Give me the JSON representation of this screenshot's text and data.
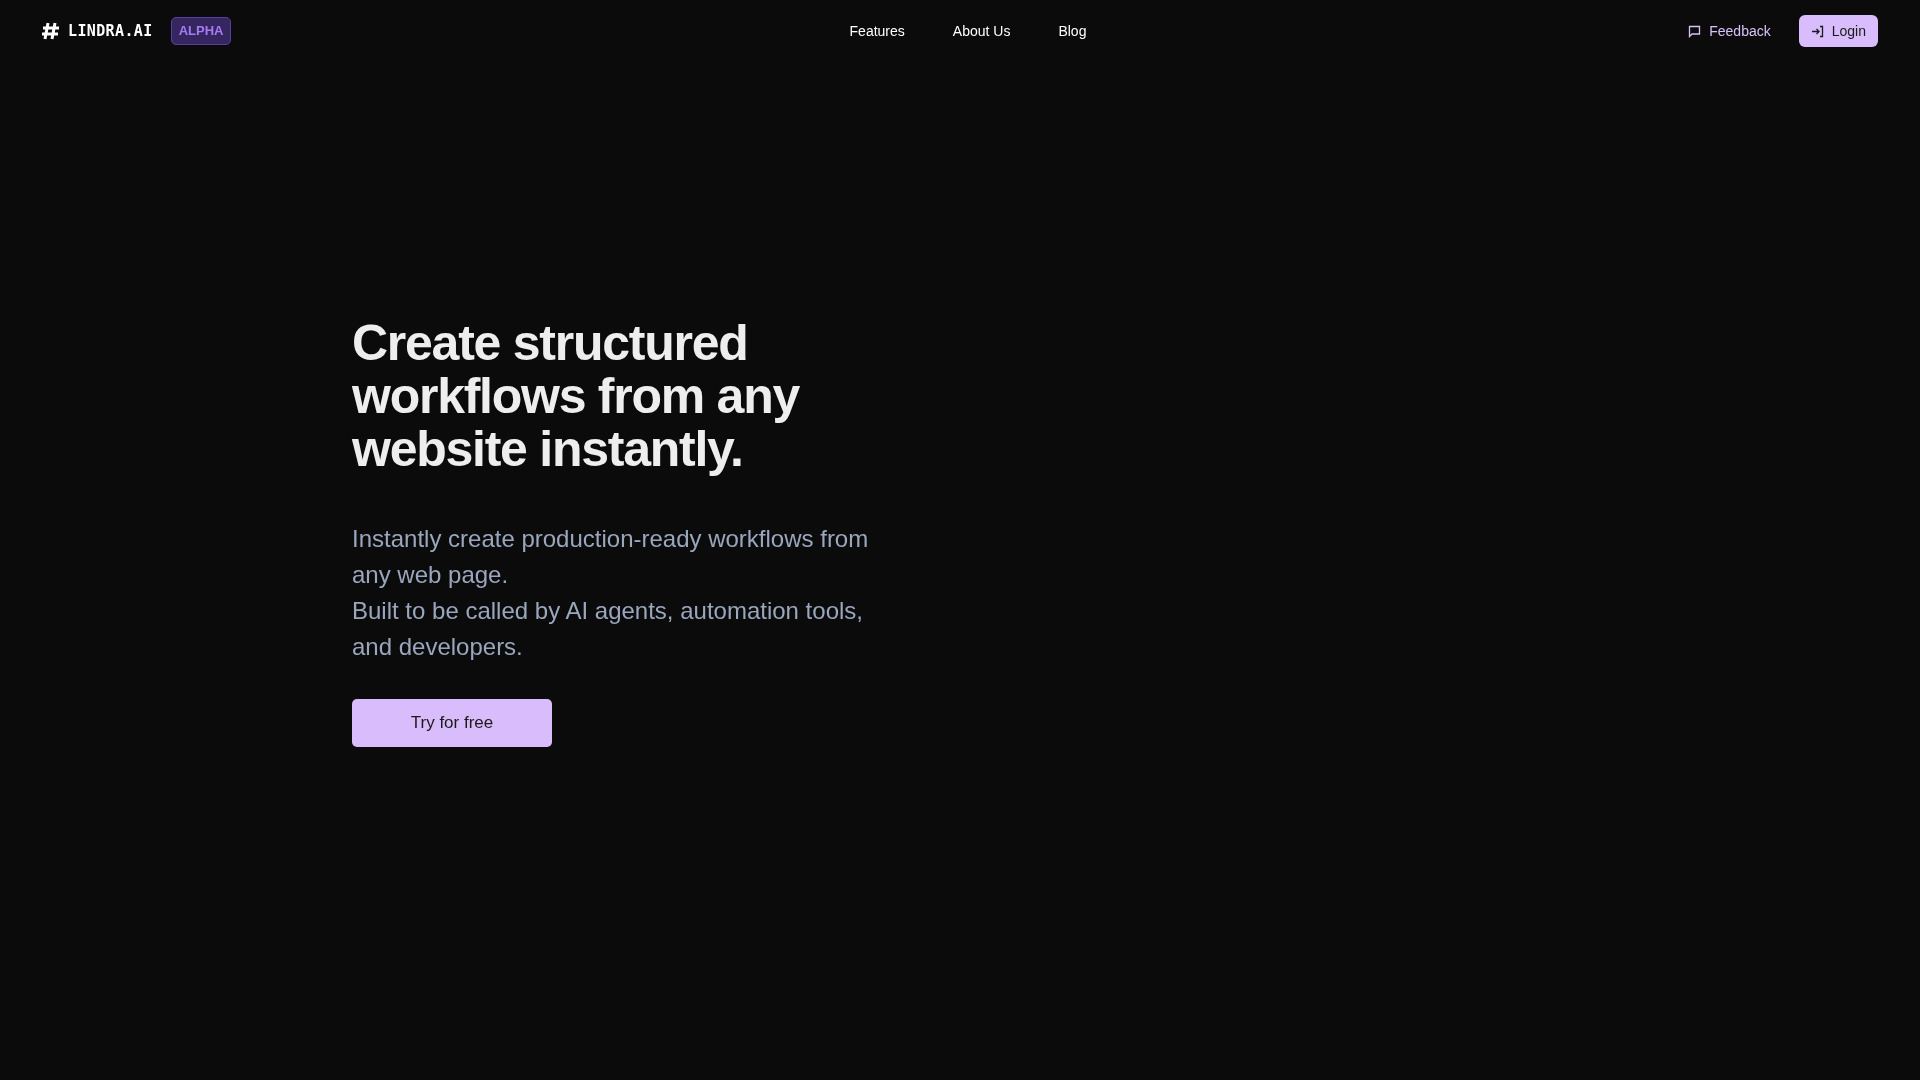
{
  "header": {
    "logo": "LINDRA.AI",
    "badge": "ALPHA",
    "nav": [
      {
        "label": "Features"
      },
      {
        "label": "About Us"
      },
      {
        "label": "Blog"
      }
    ],
    "feedback": "Feedback",
    "login": "Login"
  },
  "hero": {
    "title": "Create structured workflows from any website instantly.",
    "subtitle": [
      "Instantly create production-ready workflows from any web page.",
      "Built to be called by AI agents, automation tools, and developers."
    ],
    "cta": "Try for free"
  }
}
